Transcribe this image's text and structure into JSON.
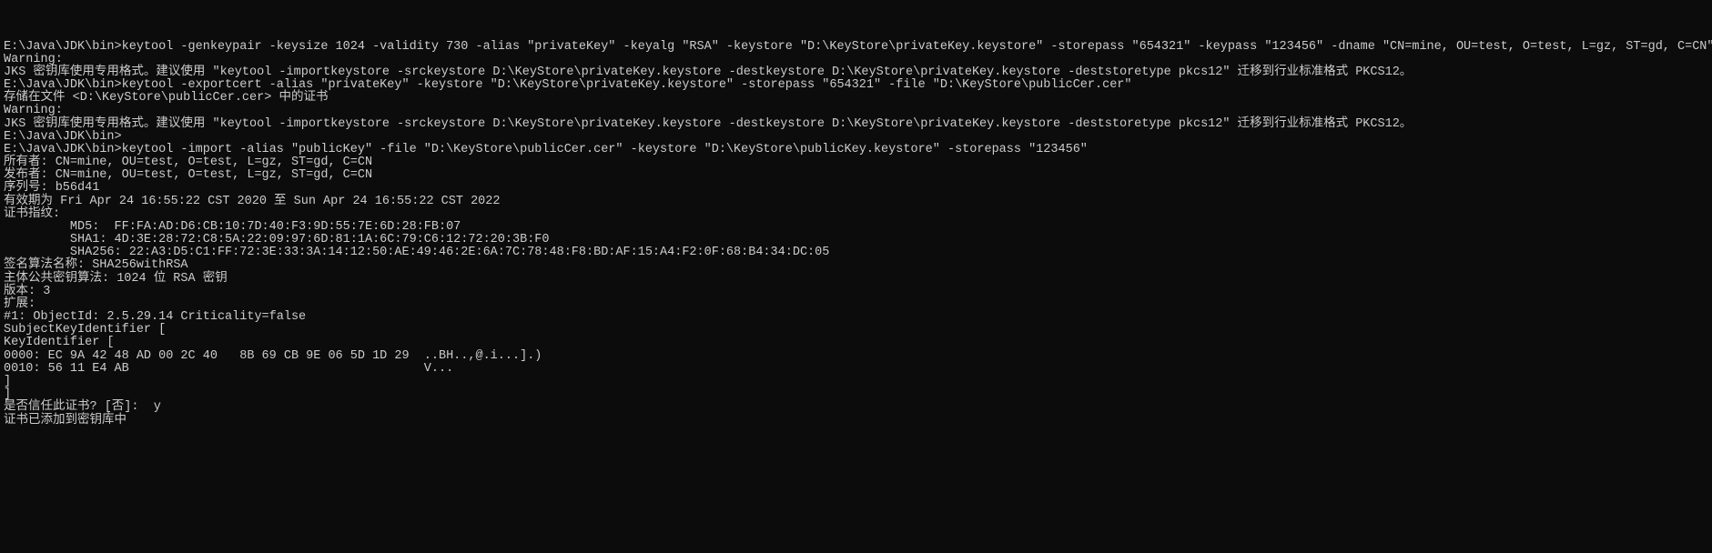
{
  "lines": [
    {
      "name": "truncated-top",
      "text": ""
    },
    {
      "name": "cmd1",
      "text": "E:\\Java\\JDK\\bin>keytool -genkeypair -keysize 1024 -validity 730 -alias \"privateKey\" -keyalg \"RSA\" -keystore \"D:\\KeyStore\\privateKey.keystore\" -storepass \"654321\" -keypass \"123456\" -dname \"CN=mine, OU=test, O=test, L=gz, ST=gd, C=CN\""
    },
    {
      "name": "blank1",
      "text": ""
    },
    {
      "name": "warn1a",
      "text": "Warning:"
    },
    {
      "name": "warn1b",
      "text": "JKS 密钥库使用专用格式。建议使用 \"keytool -importkeystore -srckeystore D:\\KeyStore\\privateKey.keystore -destkeystore D:\\KeyStore\\privateKey.keystore -deststoretype pkcs12\" 迁移到行业标准格式 PKCS12。"
    },
    {
      "name": "blank2",
      "text": ""
    },
    {
      "name": "cmd2",
      "text": "E:\\Java\\JDK\\bin>keytool -exportcert -alias \"privateKey\" -keystore \"D:\\KeyStore\\privateKey.keystore\" -storepass \"654321\" -file \"D:\\KeyStore\\publicCer.cer\""
    },
    {
      "name": "out2",
      "text": "存储在文件 <D:\\KeyStore\\publicCer.cer> 中的证书"
    },
    {
      "name": "blank3",
      "text": ""
    },
    {
      "name": "warn2a",
      "text": "Warning:"
    },
    {
      "name": "warn2b",
      "text": "JKS 密钥库使用专用格式。建议使用 \"keytool -importkeystore -srckeystore D:\\KeyStore\\privateKey.keystore -destkeystore D:\\KeyStore\\privateKey.keystore -deststoretype pkcs12\" 迁移到行业标准格式 PKCS12。"
    },
    {
      "name": "blank4",
      "text": ""
    },
    {
      "name": "prompt-blank",
      "text": "E:\\Java\\JDK\\bin>"
    },
    {
      "name": "cmd3",
      "text": "E:\\Java\\JDK\\bin>keytool -import -alias \"publicKey\" -file \"D:\\KeyStore\\publicCer.cer\" -keystore \"D:\\KeyStore\\publicKey.keystore\" -storepass \"123456\""
    },
    {
      "name": "owner",
      "text": "所有者: CN=mine, OU=test, O=test, L=gz, ST=gd, C=CN"
    },
    {
      "name": "issuer",
      "text": "发布者: CN=mine, OU=test, O=test, L=gz, ST=gd, C=CN"
    },
    {
      "name": "serial",
      "text": "序列号: b56d41"
    },
    {
      "name": "validity",
      "text": "有效期为 Fri Apr 24 16:55:22 CST 2020 至 Sun Apr 24 16:55:22 CST 2022"
    },
    {
      "name": "fingerprints",
      "text": "证书指纹:"
    },
    {
      "name": "md5",
      "text": "         MD5:  FF:FA:AD:D6:CB:10:7D:40:F3:9D:55:7E:6D:28:FB:07"
    },
    {
      "name": "sha1",
      "text": "         SHA1: 4D:3E:28:72:C8:5A:22:09:97:6D:81:1A:6C:79:C6:12:72:20:3B:F0"
    },
    {
      "name": "sha256",
      "text": "         SHA256: 22:A3:D5:C1:FF:72:3E:33:3A:14:12:50:AE:49:46:2E:6A:7C:78:48:F8:BD:AF:15:A4:F2:0F:68:B4:34:DC:05"
    },
    {
      "name": "sigalg",
      "text": "签名算法名称: SHA256withRSA"
    },
    {
      "name": "pubkeyalg",
      "text": "主体公共密钥算法: 1024 位 RSA 密钥"
    },
    {
      "name": "version",
      "text": "版本: 3"
    },
    {
      "name": "blank5",
      "text": ""
    },
    {
      "name": "extensions",
      "text": "扩展: "
    },
    {
      "name": "blank6",
      "text": ""
    },
    {
      "name": "ext1",
      "text": "#1: ObjectId: 2.5.29.14 Criticality=false"
    },
    {
      "name": "ski",
      "text": "SubjectKeyIdentifier ["
    },
    {
      "name": "kid",
      "text": "KeyIdentifier ["
    },
    {
      "name": "hex1",
      "text": "0000: EC 9A 42 48 AD 00 2C 40   8B 69 CB 9E 06 5D 1D 29  ..BH..,@.i...].)"
    },
    {
      "name": "hex2",
      "text": "0010: 56 11 E4 AB                                        V..."
    },
    {
      "name": "close1",
      "text": "]"
    },
    {
      "name": "close2",
      "text": "]"
    },
    {
      "name": "blank7",
      "text": ""
    },
    {
      "name": "trust-prompt",
      "text": "是否信任此证书? [否]:  y"
    },
    {
      "name": "added",
      "text": "证书已添加到密钥库中"
    }
  ]
}
